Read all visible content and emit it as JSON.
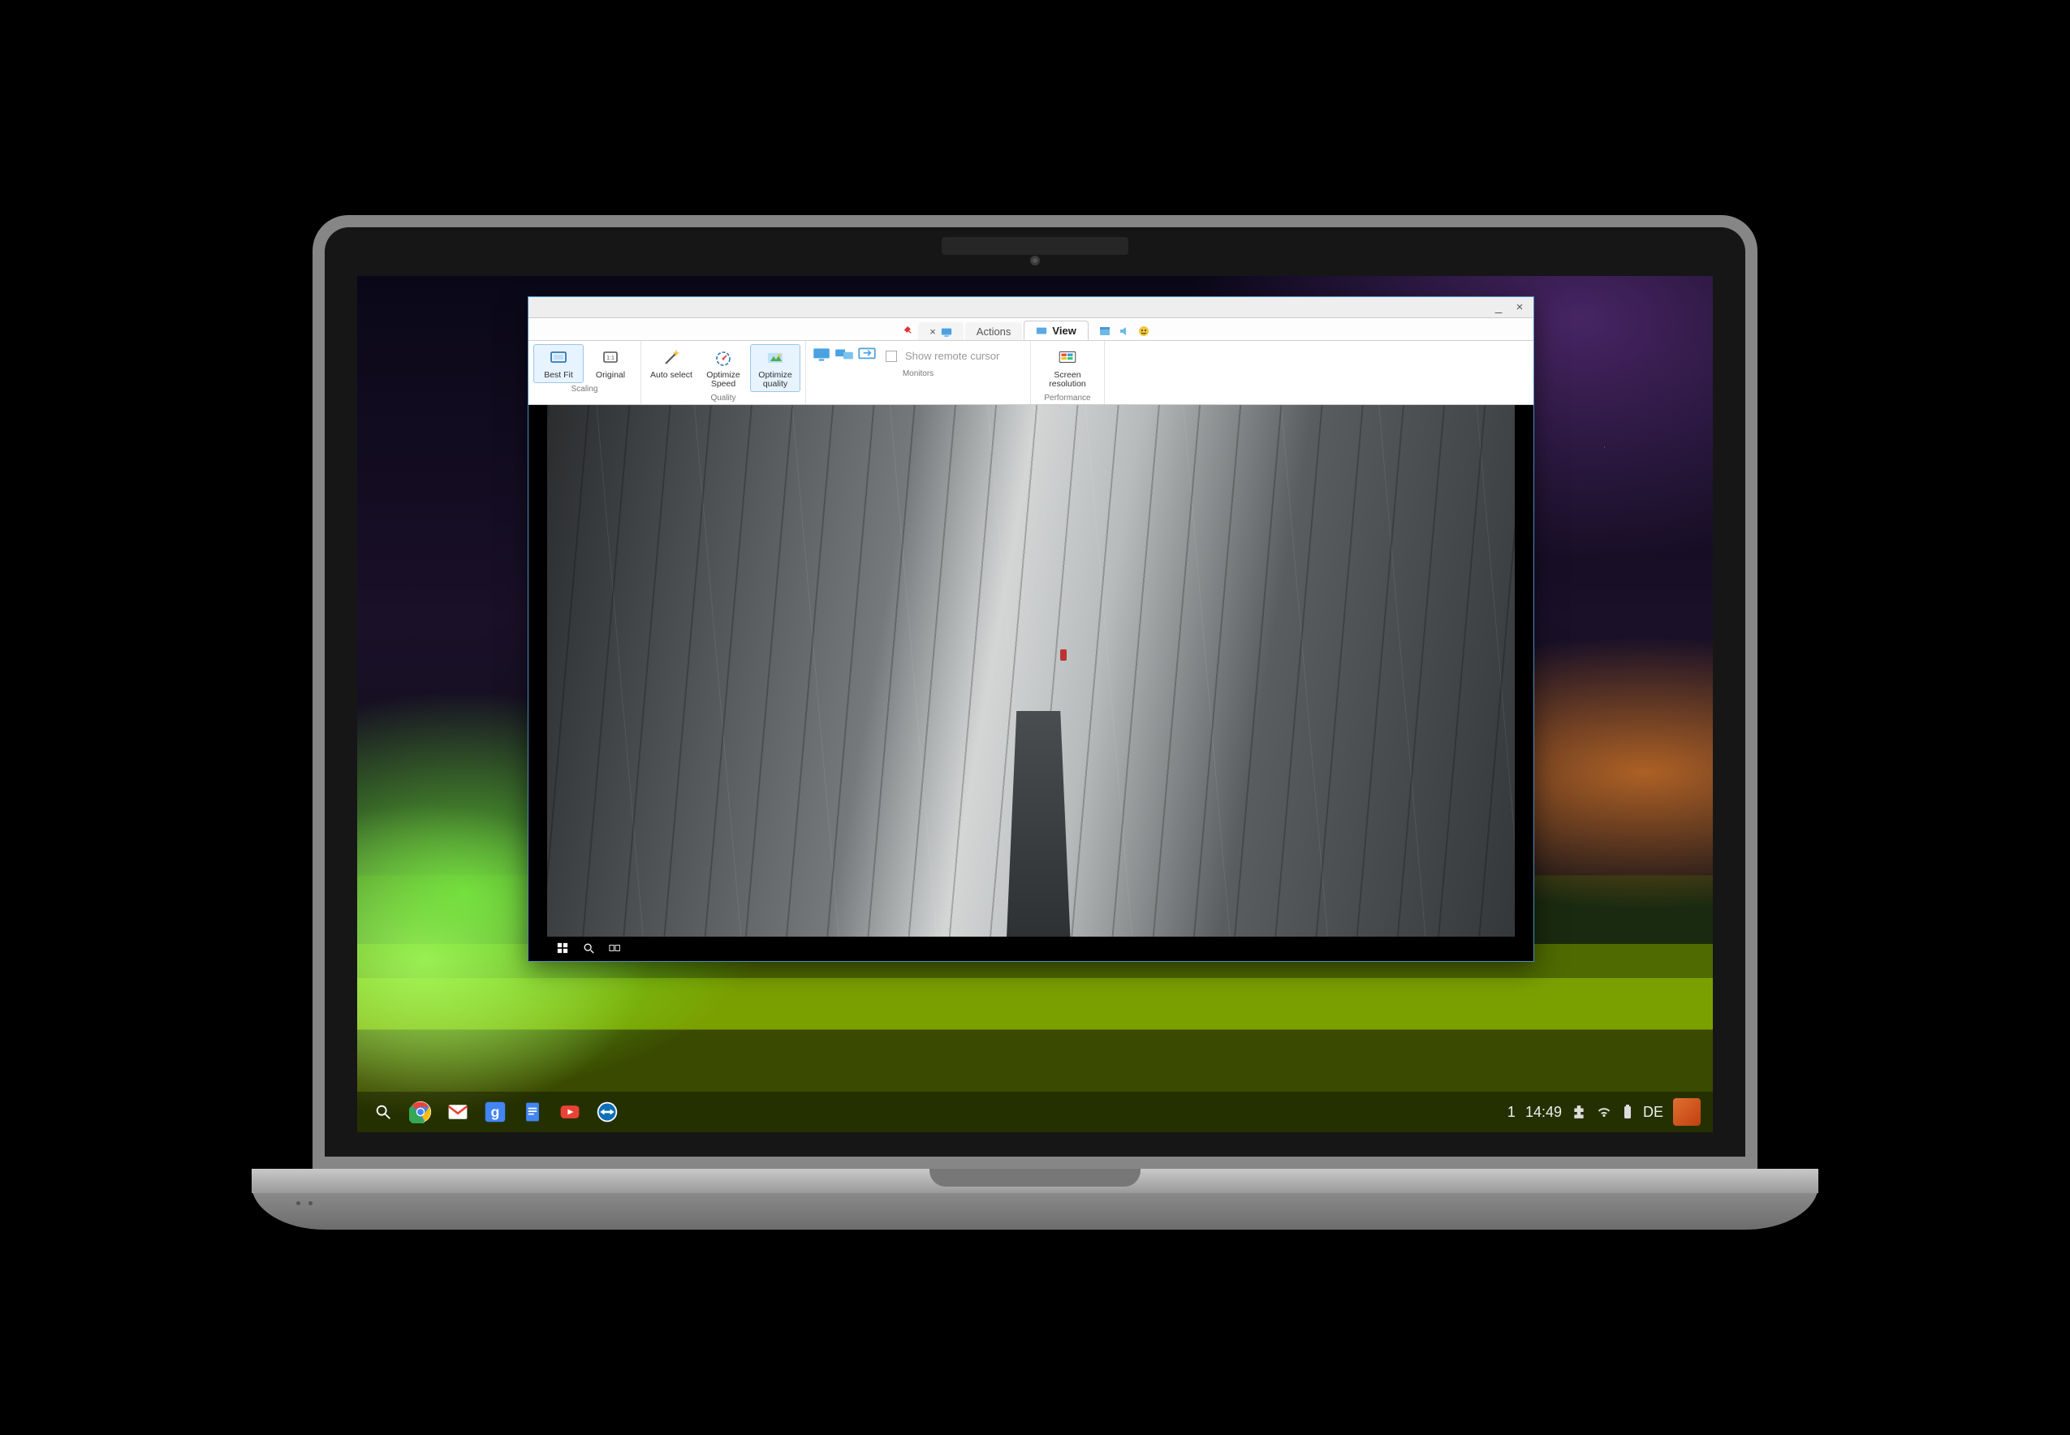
{
  "remote_window": {
    "tabs": {
      "close_glyph": "×",
      "actions": "Actions",
      "view": "View"
    },
    "ribbon": {
      "scaling": {
        "label": "Scaling",
        "best_fit": "Best Fit",
        "original": "Original"
      },
      "quality": {
        "label": "Quality",
        "auto_select": "Auto select",
        "optimize_speed": "Optimize Speed",
        "optimize_quality": "Optimize quality"
      },
      "monitors": {
        "label": "Monitors",
        "show_remote_cursor": "Show remote cursor"
      },
      "performance": {
        "label": "Performance",
        "screen_resolution": "Screen resolution"
      }
    },
    "window_controls": {
      "minimize": "_",
      "close": "×"
    }
  },
  "shelf": {
    "apps": [
      "chrome",
      "gmail",
      "google",
      "google-docs",
      "youtube",
      "teamviewer"
    ],
    "tray": {
      "notifications": "1",
      "time": "14:49",
      "lang": "DE"
    }
  }
}
